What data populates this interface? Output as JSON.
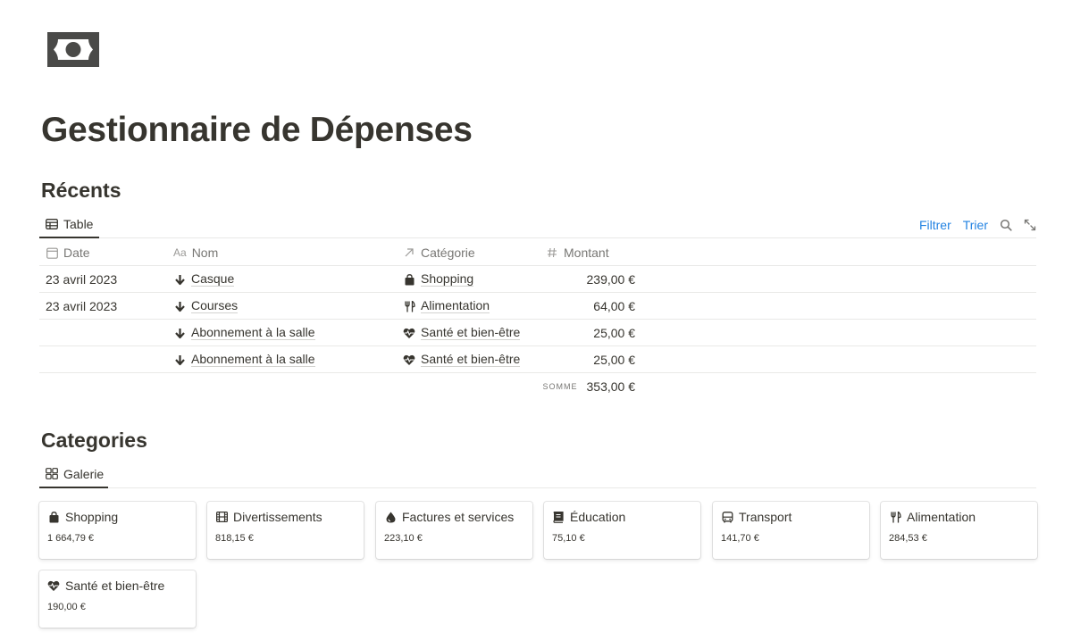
{
  "page": {
    "icon": "money-bill-icon",
    "title": "Gestionnaire de Dépenses"
  },
  "recents": {
    "title": "Récents",
    "view_tab": {
      "label": "Table",
      "icon": "table-icon"
    },
    "toolbar": {
      "filter_label": "Filtrer",
      "sort_label": "Trier",
      "search_icon": "search-icon",
      "expand_icon": "expand-icon"
    },
    "columns": [
      {
        "label": "Date",
        "icon": "calendar-icon"
      },
      {
        "label": "Nom",
        "icon": "text-aa-icon"
      },
      {
        "label": "Catégorie",
        "icon": "relation-arrow-icon"
      },
      {
        "label": "Montant",
        "icon": "hash-icon"
      }
    ],
    "rows": [
      {
        "date": "23 avril 2023",
        "name": "Casque",
        "name_icon": "arrow-down-icon",
        "category": "Shopping",
        "category_icon": "shopping-bag-icon",
        "amount": "239,00 €"
      },
      {
        "date": "23 avril 2023",
        "name": "Courses",
        "name_icon": "arrow-down-icon",
        "category": "Alimentation",
        "category_icon": "fork-knife-icon",
        "amount": "64,00 €"
      },
      {
        "date": "",
        "name": "Abonnement à la salle",
        "name_icon": "arrow-down-icon",
        "category": "Santé et bien-être",
        "category_icon": "heart-pulse-icon",
        "amount": "25,00 €"
      },
      {
        "date": "",
        "name": "Abonnement à la salle",
        "name_icon": "arrow-down-icon",
        "category": "Santé et bien-être",
        "category_icon": "heart-pulse-icon",
        "amount": "25,00 €"
      }
    ],
    "sum": {
      "label": "SOMME",
      "value": "353,00 €"
    }
  },
  "categories": {
    "title": "Categories",
    "view_tab": {
      "label": "Galerie",
      "icon": "gallery-icon"
    },
    "cards": [
      {
        "name": "Shopping",
        "icon": "shopping-bag-icon",
        "amount": "1 664,79 €"
      },
      {
        "name": "Divertissements",
        "icon": "film-icon",
        "amount": "818,15 €"
      },
      {
        "name": "Factures et services",
        "icon": "drop-icon",
        "amount": "223,10 €"
      },
      {
        "name": "Éducation",
        "icon": "book-icon",
        "amount": "75,10 €"
      },
      {
        "name": "Transport",
        "icon": "bus-icon",
        "amount": "141,70 €"
      },
      {
        "name": "Alimentation",
        "icon": "fork-knife-icon",
        "amount": "284,53 €"
      },
      {
        "name": "Santé et bien-être",
        "icon": "heart-pulse-icon",
        "amount": "190,00 €"
      }
    ]
  },
  "colors": {
    "text": "#37352f",
    "muted": "#787774",
    "link": "#2383e2",
    "icon": "#4a4a48"
  }
}
